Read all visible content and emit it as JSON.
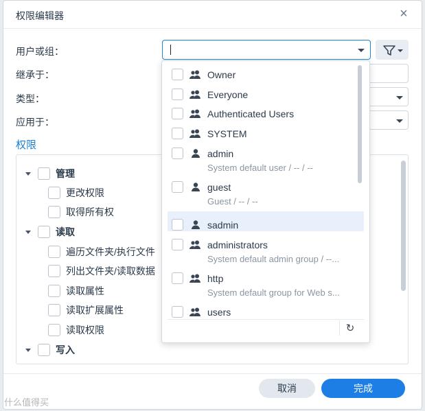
{
  "dialog": {
    "title": "权限编辑器",
    "close_label": "×"
  },
  "form": {
    "user_group_label": "用户或组：",
    "inherit_label": "继承于：",
    "type_label": "类型：",
    "apply_label": "应用于：",
    "permissions_link": "权限",
    "user_group_value": ""
  },
  "tree": {
    "items": [
      {
        "label": "管理",
        "level": 0
      },
      {
        "label": "更改权限",
        "level": 1
      },
      {
        "label": "取得所有权",
        "level": 1
      },
      {
        "label": "读取",
        "level": 0
      },
      {
        "label": "遍历文件夹/执行文件",
        "level": 1
      },
      {
        "label": "列出文件夹/读取数据",
        "level": 1
      },
      {
        "label": "读取属性",
        "level": 1
      },
      {
        "label": "读取扩展属性",
        "level": 1
      },
      {
        "label": "读取权限",
        "level": 1
      },
      {
        "label": "写入",
        "level": 0
      }
    ]
  },
  "dropdown": {
    "items": [
      {
        "name": "Owner",
        "type": "group",
        "desc": ""
      },
      {
        "name": "Everyone",
        "type": "group",
        "desc": ""
      },
      {
        "name": "Authenticated Users",
        "type": "group",
        "desc": ""
      },
      {
        "name": "SYSTEM",
        "type": "group",
        "desc": ""
      },
      {
        "name": "admin",
        "type": "user",
        "desc": "System default user / -- / --"
      },
      {
        "name": "guest",
        "type": "user",
        "desc": "Guest / -- / --"
      },
      {
        "name": "sadmin",
        "type": "user",
        "desc": "",
        "selected": true
      },
      {
        "name": "administrators",
        "type": "group",
        "desc": "System default admin group / --..."
      },
      {
        "name": "http",
        "type": "group",
        "desc": "System default group for Web s..."
      },
      {
        "name": "users",
        "type": "group",
        "desc": ""
      }
    ],
    "refresh_icon": "↻"
  },
  "footer": {
    "cancel_label": "取消",
    "ok_label": "完成"
  },
  "watermark": "什么值得买",
  "colors": {
    "accent": "#1d7fe6",
    "link": "#1d7fd1",
    "selected_row": "#e8f1fb"
  }
}
